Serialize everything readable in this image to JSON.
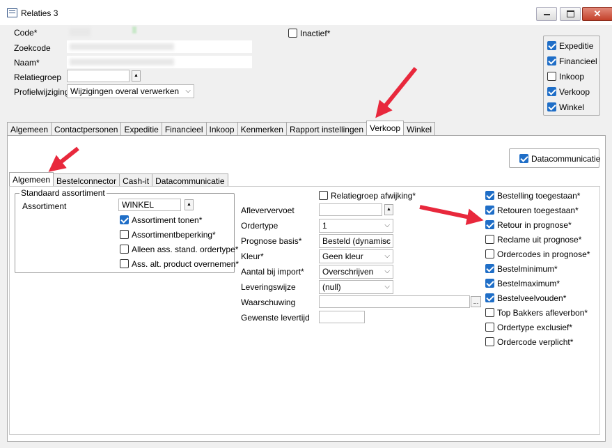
{
  "window": {
    "title": "Relaties 3"
  },
  "header": {
    "code_label": "Code*",
    "zoekcode_label": "Zoekcode",
    "naam_label": "Naam*",
    "relatiegroep_label": "Relatiegroep",
    "profielwijziging_label": "Profielwijziging*",
    "profielwijziging_value": "Wijzigingen overal verwerken",
    "inactief_label": "Inactief*"
  },
  "flags": [
    {
      "label": "Expeditie",
      "checked": true
    },
    {
      "label": "Financieel",
      "checked": true
    },
    {
      "label": "Inkoop",
      "checked": false
    },
    {
      "label": "Verkoop",
      "checked": true
    },
    {
      "label": "Winkel",
      "checked": true
    }
  ],
  "main_tabs": [
    "Algemeen",
    "Contactpersonen",
    "Expeditie",
    "Financieel",
    "Inkoop",
    "Kenmerken",
    "Rapport instellingen",
    "Verkoop",
    "Winkel"
  ],
  "datacommunicatie_button": "Datacommunicatie",
  "sub_tabs": [
    "Algemeen",
    "Bestelconnector",
    "Cash-it",
    "Datacommunicatie"
  ],
  "standaard": {
    "group_title": "Standaard assortiment",
    "assortiment_label": "Assortiment",
    "assortiment_value": "WINKEL",
    "checks": [
      {
        "label": "Assortiment tonen*",
        "checked": true
      },
      {
        "label": "Assortimentbeperking*",
        "checked": false
      },
      {
        "label": "Alleen ass. stand. ordertype*",
        "checked": false
      },
      {
        "label": "Ass. alt. product overnemen*",
        "checked": false
      }
    ]
  },
  "middle": {
    "relatiegroep_afwijking": "Relatiegroep afwijking*",
    "fields": [
      {
        "label": "Afleververvoet",
        "value": ""
      },
      {
        "label": "Ordertype",
        "value": "1"
      },
      {
        "label": "Prognose basis*",
        "value": "Besteld (dynamisc"
      },
      {
        "label": "Kleur*",
        "value": "Geen kleur"
      },
      {
        "label": "Aantal bij import*",
        "value": "Overschrijven"
      },
      {
        "label": "Leveringswijze",
        "value": "(null)"
      },
      {
        "label": "Waarschuwing",
        "value": ""
      },
      {
        "label": "Gewenste levertijd",
        "value": ""
      }
    ]
  },
  "right_checks": [
    {
      "label": "Bestelling toegestaan*",
      "checked": true
    },
    {
      "label": "Retouren toegestaan*",
      "checked": true
    },
    {
      "label": "Retour in prognose*",
      "checked": true
    },
    {
      "label": "Reclame uit prognose*",
      "checked": false
    },
    {
      "label": "Ordercodes in prognose*",
      "checked": false
    },
    {
      "label": "Bestelminimum*",
      "checked": true
    },
    {
      "label": "Bestelmaximum*",
      "checked": true
    },
    {
      "label": "Bestelveelvouden*",
      "checked": true
    },
    {
      "label": "Top Bakkers afleverbon*",
      "checked": false
    },
    {
      "label": "Ordertype exclusief*",
      "checked": false
    },
    {
      "label": "Ordercode verplicht*",
      "checked": false
    }
  ],
  "colors": {
    "checkbox": "#1f6ec7",
    "arrow": "#e8283c",
    "close": "#c4412a"
  }
}
